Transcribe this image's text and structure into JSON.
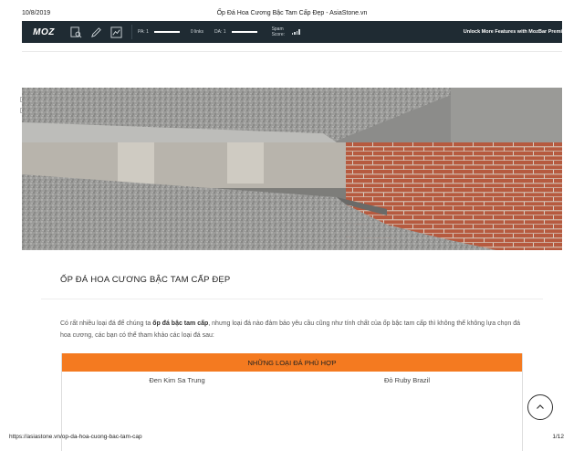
{
  "print_header": {
    "date": "10/8/2019",
    "title": "Ốp Đá Hoa Cương Bậc Tam Cấp Đẹp - AsiaStone.vn"
  },
  "mozbar": {
    "logo": "MOZ",
    "icons": [
      "page-analysis-icon",
      "highlight-pen-icon",
      "mozbar-settings-icon"
    ],
    "pa_label": "PA: 1",
    "links_label": "0 links",
    "da_label": "DA: 1",
    "spam_label": "Spam Score:",
    "unlock_text": "Unlock More Features with MozBar Premi"
  },
  "article": {
    "title": "ỐP ĐÁ HOA CƯƠNG BẬC TAM CẤP ĐẸP",
    "intro_before": "Có rất nhiều loại đá để chúng ta ",
    "intro_bold": "ốp đá bậc tam cấp",
    "intro_after": ", nhưng loại đá nào đảm bảo yêu cầu cũng như tính chất của ốp bậc tam cấp thì không thể không lựa chọn đá hoa cương, các bạn có thể tham khảo các loại đá sau:",
    "table_header": "NHỮNG LOẠI ĐÁ PHÙ HỢP",
    "table_rows": [
      [
        "Đen Kim Sa Trung",
        "Đỏ Ruby Brazil"
      ]
    ]
  },
  "print_footer": {
    "url": "https://asiastone.vn/op-da-hoa-cuong-bac-tam-cap",
    "page": "1/12"
  },
  "colors": {
    "mozbar_bg": "#1f2b33",
    "table_header_bg": "#f47a20",
    "brick": "#a8553d"
  }
}
